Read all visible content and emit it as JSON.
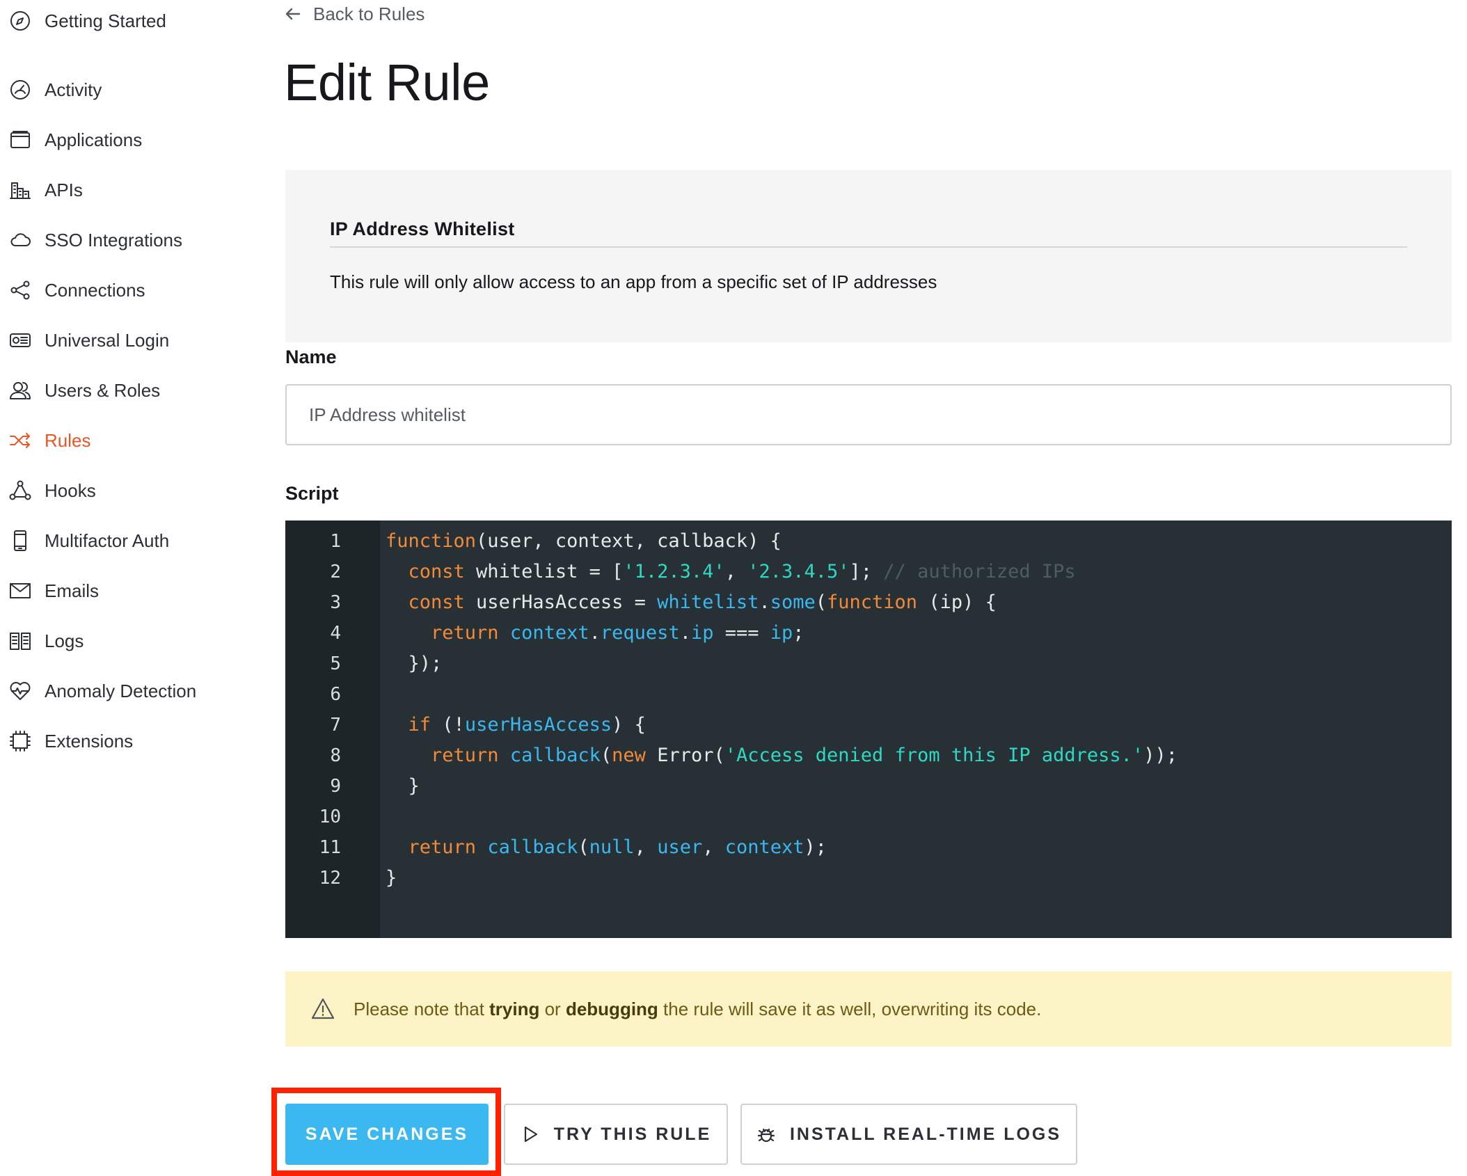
{
  "sidebar": {
    "items": [
      {
        "label": "Getting Started",
        "icon": "compass-icon",
        "active": false
      },
      {
        "label": "Activity",
        "icon": "gauge-icon",
        "active": false
      },
      {
        "label": "Applications",
        "icon": "window-icon",
        "active": false
      },
      {
        "label": "APIs",
        "icon": "buildings-icon",
        "active": false
      },
      {
        "label": "SSO Integrations",
        "icon": "cloud-icon",
        "active": false
      },
      {
        "label": "Connections",
        "icon": "share-nodes-icon",
        "active": false
      },
      {
        "label": "Universal Login",
        "icon": "login-card-icon",
        "active": false
      },
      {
        "label": "Users & Roles",
        "icon": "users-icon",
        "active": false
      },
      {
        "label": "Rules",
        "icon": "shuffle-icon",
        "active": true
      },
      {
        "label": "Hooks",
        "icon": "hooks-icon",
        "active": false
      },
      {
        "label": "Multifactor Auth",
        "icon": "phone-icon",
        "active": false
      },
      {
        "label": "Emails",
        "icon": "envelope-icon",
        "active": false
      },
      {
        "label": "Logs",
        "icon": "book-icon",
        "active": false
      },
      {
        "label": "Anomaly Detection",
        "icon": "heart-pulse-icon",
        "active": false
      },
      {
        "label": "Extensions",
        "icon": "chip-icon",
        "active": false
      }
    ],
    "active_color": "#eb5424"
  },
  "header": {
    "back_label": "Back to Rules",
    "title": "Edit Rule"
  },
  "info": {
    "title": "IP Address Whitelist",
    "description": "This rule will only allow access to an app from a specific set of IP addresses"
  },
  "form": {
    "name_label": "Name",
    "name_value": "IP Address whitelist",
    "script_label": "Script"
  },
  "editor": {
    "line_numbers": [
      "1",
      "2",
      "3",
      "4",
      "5",
      "6",
      "7",
      "8",
      "9",
      "10",
      "11",
      "12"
    ]
  },
  "notice": {
    "prefix": "Please note that ",
    "bold1": "trying",
    "middle": " or ",
    "bold2": "debugging",
    "suffix": " the rule will save it as well, overwriting its code."
  },
  "buttons": {
    "save": "SAVE CHANGES",
    "try": "TRY THIS RULE",
    "logs": "INSTALL REAL-TIME LOGS"
  },
  "colors": {
    "accent": "#3cb8f0",
    "editor_bg": "#263035",
    "notice_bg": "#fcf3c6",
    "highlight": "#ff2200"
  }
}
